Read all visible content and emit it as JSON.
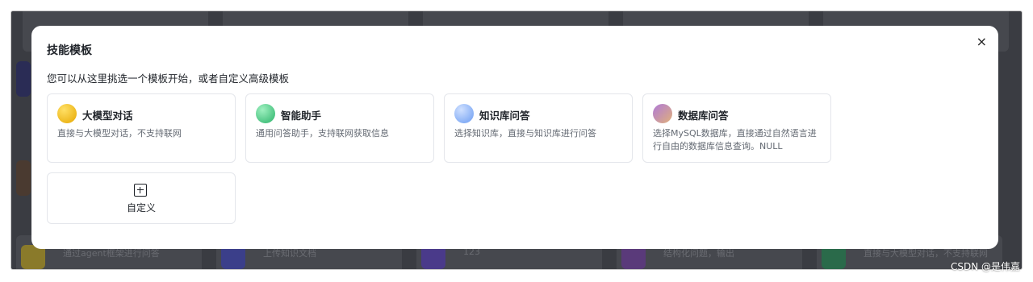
{
  "background": {
    "items": [
      {
        "text": "通过agent框架进行问答"
      },
      {
        "text": "上传知识文档"
      },
      {
        "text": "123"
      },
      {
        "text": "结构化问题，输出"
      },
      {
        "text": "直接与大模型对话，不支持联网"
      }
    ]
  },
  "modal": {
    "title": "技能模板",
    "subtitle": "您可以从这里挑选一个模板开始，或者自定义高级模板",
    "close_icon": "×",
    "templates": [
      {
        "name": "大模型对话",
        "desc": "直接与大模型对话，不支持联网",
        "icon_color": "#e6a700"
      },
      {
        "name": "智能助手",
        "desc": "通用问答助手，支持联网获取信息",
        "icon_color": "#2bb36a"
      },
      {
        "name": "知识库问答",
        "desc": "选择知识库，直接与知识库进行问答",
        "icon_color": "#6b9cf2"
      },
      {
        "name": "数据库问答",
        "desc": "选择MySQL数据库，直接通过自然语言进行自由的数据库信息查询。NULL",
        "icon_color": "#c98a9a"
      }
    ],
    "custom": {
      "label": "自定义",
      "icon": "plus-square-icon"
    }
  },
  "watermark": "CSDN @是伟嘉"
}
